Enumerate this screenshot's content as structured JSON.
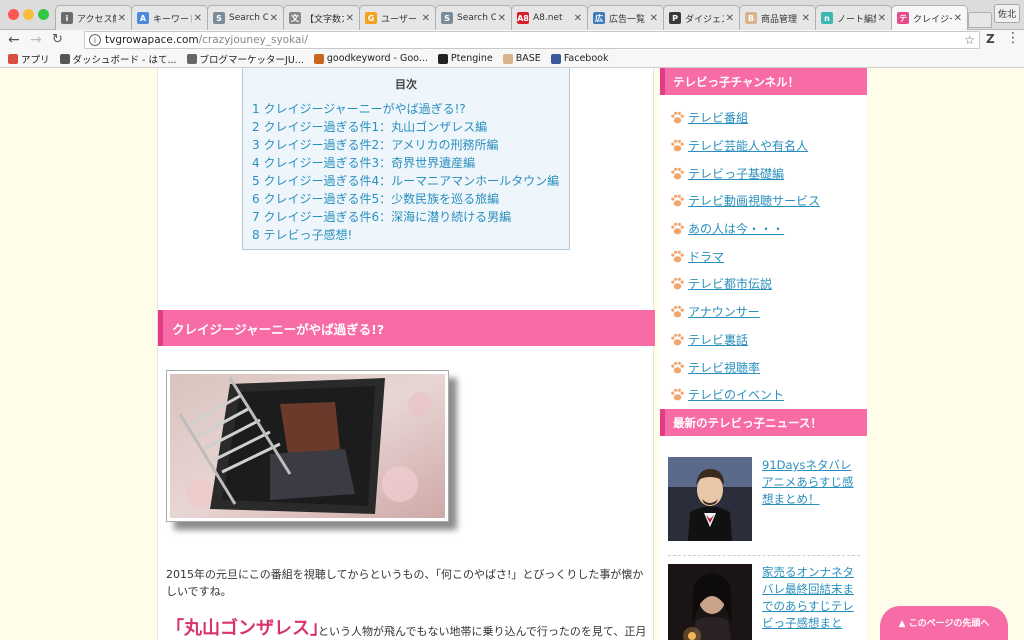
{
  "browser": {
    "tabs": [
      {
        "label": "アクセス解析",
        "fav_color": "#6c6c6c",
        "fav_glyph": "i"
      },
      {
        "label": "キーワードプランナー",
        "fav_color": "#4a8be0",
        "fav_glyph": "A"
      },
      {
        "label": "Search Console",
        "fav_color": "#7a8b99",
        "fav_glyph": "S"
      },
      {
        "label": "【文字数カウント】",
        "fav_color": "#888888",
        "fav_glyph": "文"
      },
      {
        "label": "ユーザー",
        "fav_color": "#f4a11c",
        "fav_glyph": "G"
      },
      {
        "label": "Search Console",
        "fav_color": "#7a8b99",
        "fav_glyph": "S"
      },
      {
        "label": "A8.net",
        "fav_color": "#d8202c",
        "fav_glyph": "A8"
      },
      {
        "label": "広告一覧",
        "fav_color": "#3e7bbf",
        "fav_glyph": "広"
      },
      {
        "label": "ダイジェスト",
        "fav_color": "#3a3a3a",
        "fav_glyph": "P"
      },
      {
        "label": "商品管理",
        "fav_color": "#d9b38c",
        "fav_glyph": "B"
      },
      {
        "label": "ノート編集",
        "fav_color": "#3cb6b0",
        "fav_glyph": "n"
      },
      {
        "label": "クレイジー",
        "fav_color": "#e34b8a",
        "fav_glyph": "テ",
        "active": true
      }
    ],
    "close_glyph": "✕",
    "profile_label": "佐北",
    "url_host": "tvgrowapace.com",
    "url_path": "/crazyjouney_syokai/",
    "bookmarks": [
      {
        "label": "アプリ",
        "color": "#d94f3d"
      },
      {
        "label": "ダッシュボード - はて...",
        "color": "#555555"
      },
      {
        "label": "ブログマーケッターJU...",
        "color": "#666666"
      },
      {
        "label": "goodkeyword - Goo...",
        "color": "#c9651e"
      },
      {
        "label": "Ptengine",
        "color": "#222222"
      },
      {
        "label": "BASE",
        "color": "#d9b38c"
      },
      {
        "label": "Facebook",
        "color": "#3b5998"
      }
    ]
  },
  "toc": {
    "title": "目次",
    "items": [
      "1 クレイジージャーニーがやば過ぎる!?",
      "2 クレイジー過ぎる件1：丸山ゴンザレス編",
      "3 クレイジー過ぎる件2：アメリカの刑務所編",
      "4 クレイジー過ぎる件3：奇界世界遺産編",
      "5 クレイジー過ぎる件4：ルーマニアマンホールタウン編",
      "6 クレイジー過ぎる件5：少数民族を巡る旅編",
      "7 クレイジー過ぎる件6：深海に潜り続ける男編",
      "8 テレビっ子感想!"
    ]
  },
  "article": {
    "heading": "クレイジージャーニーがやば過ぎる!?",
    "paragraph": "2015年の元旦にこの番組を視聴してからというもの、「何このやばさ!」とびっくりした事が懐かしいですね。",
    "highlight": "「丸山ゴンザレス」",
    "paragraph2": "という人物が飛んでもない地帯に乗り込んで行ったのを見て、正月"
  },
  "sidebar": {
    "channel_heading": "テレビっ子チャンネル！",
    "categories": [
      "テレビ番組",
      "テレビ芸能人や有名人",
      "テレビっ子基礎編",
      "テレビ動画視聴サービス",
      "あの人は今・・・",
      "ドラマ",
      "テレビ都市伝説",
      "アナウンサー",
      "テレビ裏話",
      "テレビ視聴率",
      "テレビのイベント"
    ],
    "news_heading": "最新のテレビっ子ニュース！",
    "news": [
      {
        "title": "91Daysネタバレアニメあらすじ感想まとめ！"
      },
      {
        "title": "家売るオンナネタバレ最終回結末までのあらすじテレビっ子感想まと"
      }
    ]
  },
  "to_top_label": "▲ このページの先頭へ",
  "colors": {
    "accent_pink": "#f76ba6",
    "accent_pink_dark": "#e23c86",
    "link_blue": "#2a8fbd",
    "page_bg": "#fffde9"
  }
}
